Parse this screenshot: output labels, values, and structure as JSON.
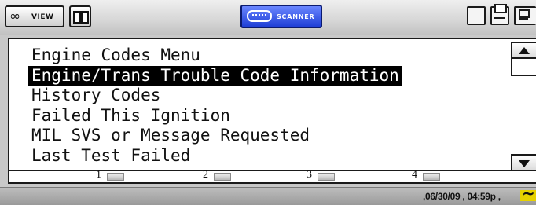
{
  "toolbar": {
    "view_label": "VIEW",
    "view_icon": "binoculars-icon",
    "split_icon": "split-screen-icon",
    "scanner_label": "SCANNER",
    "scanner_icon": "scanner-device-icon",
    "right_icons": [
      "folder-icon",
      "print-icon",
      "save-icon"
    ]
  },
  "menu": {
    "items": [
      "Engine Codes Menu",
      "Engine/Trans Trouble Code Information",
      "History Codes",
      "Failed This Ignition",
      "MIL SVS or Message Requested",
      "Last Test Failed"
    ],
    "selected_index": 1
  },
  "function_keys": [
    "1",
    "2",
    "3",
    "4"
  ],
  "status": {
    "date": "06/30/09",
    "time": "04:59p"
  },
  "colors": {
    "scanner_button": "#2a4ae0",
    "selection_bg": "#000000",
    "selection_fg": "#ffffff",
    "signal_icon": "#e6d100"
  }
}
